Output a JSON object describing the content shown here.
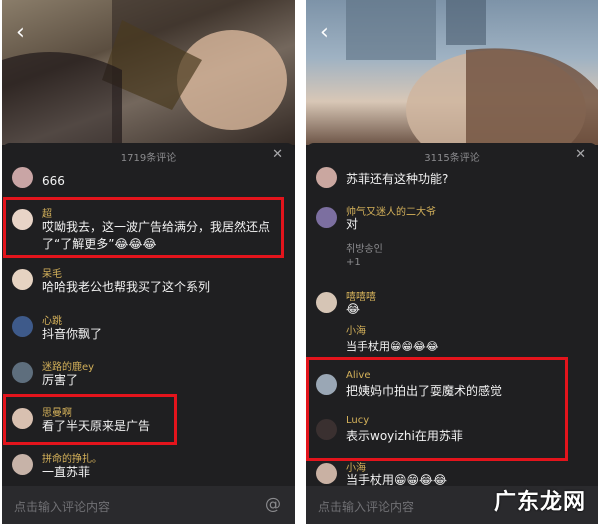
{
  "left": {
    "count": "1719条评论",
    "comments": [
      {
        "user": "",
        "text": "666"
      },
      {
        "user": "超",
        "text": "哎呦我去，这一波广告给满分，我居然还点了“了解更多”😂😂😂"
      },
      {
        "user": "呆毛",
        "text": "哈哈我老公也帮我买了这个系列"
      },
      {
        "user": "心跳",
        "text": "抖音你飘了"
      },
      {
        "user": "迷路的鹿ey",
        "text": "厉害了"
      },
      {
        "user": "思曼啊",
        "text": "看了半天原来是广告"
      },
      {
        "user": "拼命的挣扎。",
        "text": "一直苏菲"
      }
    ],
    "input_placeholder": "点击输入评论内容"
  },
  "right": {
    "count": "3115条评论",
    "comments": [
      {
        "user": "",
        "text": "苏菲还有这种功能?"
      },
      {
        "user": "帅气又迷人的二大爷",
        "text": "对",
        "reply_user": "취방송인",
        "reply_text": "+1"
      },
      {
        "user": "嘻嘻嘻",
        "text": "😂",
        "reply_user": "小海",
        "reply_text": "当手杖用😁😁😂😂"
      },
      {
        "user": "Alive",
        "text": "把姨妈巾拍出了耍魔术的感觉"
      },
      {
        "user": "Lucy",
        "text": "表示woyizhi在用苏菲"
      },
      {
        "user": "小海",
        "text": "当手杖用😁😁😂😂"
      }
    ],
    "input_placeholder": "点击输入评论内容"
  },
  "watermark": "广东龙网",
  "colors": {
    "highlight": "#e3141c",
    "username": "#d4b15a"
  }
}
